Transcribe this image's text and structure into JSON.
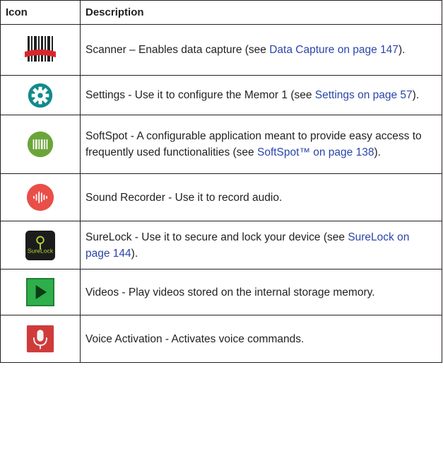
{
  "header": {
    "col_icon": "Icon",
    "col_description": "Description"
  },
  "rows": [
    {
      "icon": "scanner-icon",
      "text_before": "Scanner – Enables data capture (see ",
      "link": "Data Capture on page 147",
      "text_after": ")."
    },
    {
      "icon": "settings-gear-icon",
      "text_before": "Settings - Use it to configure the Memor 1 (see ",
      "link": "Settings on page 57",
      "text_after": ")."
    },
    {
      "icon": "softspot-barcode-icon",
      "text_before": "SoftSpot - A configurable application meant to provide easy access to frequently used functionalities (see ",
      "link": "SoftSpot™ on page 138",
      "text_after": ")."
    },
    {
      "icon": "sound-recorder-icon",
      "text_before": "Sound Recorder - Use it to record audio.",
      "link": "",
      "text_after": ""
    },
    {
      "icon": "surelock-icon",
      "text_before": "SureLock - Use it to secure and lock your device (see ",
      "link": "SureLock on page 144",
      "text_after": ")."
    },
    {
      "icon": "videos-play-icon",
      "text_before": "Videos - Play videos stored on the internal storage memory.",
      "link": "",
      "text_after": ""
    },
    {
      "icon": "voice-activation-microphone-icon",
      "text_before": "Voice Activation - Activates voice commands.",
      "link": "",
      "text_after": ""
    }
  ],
  "icon_labels": {
    "surelock": "SureLock"
  }
}
